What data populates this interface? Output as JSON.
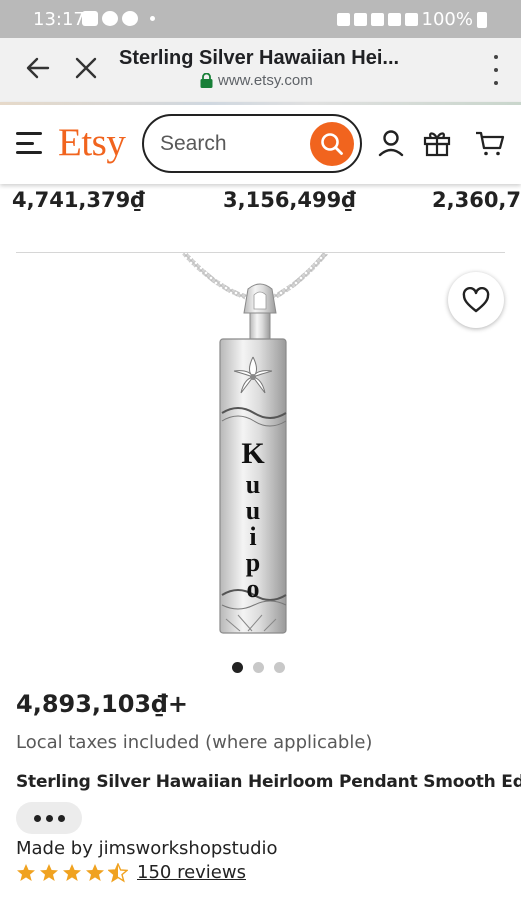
{
  "status_bar": {
    "time": "13:17",
    "battery": "100%"
  },
  "browser": {
    "page_title": "Sterling Silver Hawaiian Hei...",
    "url": "www.etsy.com"
  },
  "header": {
    "logo": "Etsy",
    "search_placeholder": "Search",
    "accent_color": "#f1641e"
  },
  "related_prices": [
    "4,741,379₫",
    "3,156,499₫",
    "2,360,7"
  ],
  "product": {
    "image_inscription": "Kuuipo",
    "carousel": {
      "total": 3,
      "active": 0
    },
    "price": "4,893,103₫+",
    "tax_note": "Local taxes included (where applicable)",
    "title": "Sterling Silver Hawaiian Heirloom Pendant Smooth Ed...",
    "seller_text": "Made by jimsworkshopstudio",
    "rating": 4.5,
    "reviews_text": "150 reviews",
    "star_color": "#f0a220"
  }
}
